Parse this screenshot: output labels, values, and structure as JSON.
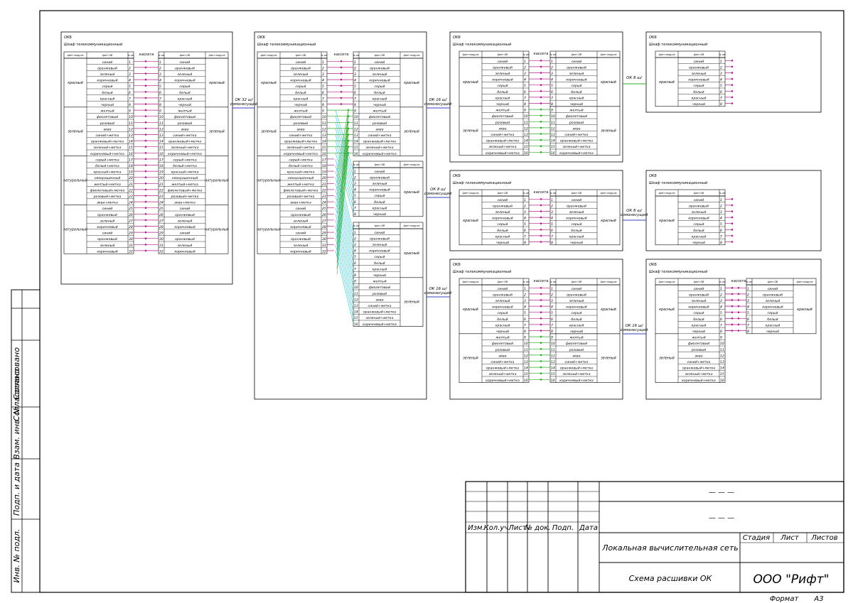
{
  "format": {
    "label": "Формат",
    "value": "А3"
  },
  "side_stamp": [
    "Инв. № подл.",
    "Подп. и дата",
    "Взам. инв. №",
    "Согласовано"
  ],
  "title_block": {
    "columns": [
      "Изм.",
      "Кол.уч.",
      "Лист",
      "№ док.",
      "Подп.",
      "Дата"
    ],
    "code_top": "— — —",
    "code_bottom": "— — —",
    "project": "Локальная вычислительная сеть",
    "sheet_title": "Схема расшивки ОК",
    "stage_hdr": "Стадия",
    "sheet_hdr": "Лист",
    "sheets_hdr": "Листов",
    "company": "ООО \"Рифт\""
  },
  "common": {
    "okb": "ОКБ",
    "cabinet": "Шкаф телекоммуникационный",
    "cassette": "кассета",
    "hdr_module": "Цвет модуля",
    "hdr_fiber": "Цвет ОВ",
    "hdr_num": "№ ОВ"
  },
  "fiber_colors": [
    "синий",
    "оранжевый",
    "зеленый",
    "коричневый",
    "серый",
    "белый",
    "красный",
    "черный",
    "желтый",
    "фиолетовый",
    "розовый",
    "аква",
    "синий+метка",
    "оранжевый+метка",
    "зеленый+метка",
    "коричневый+метка"
  ],
  "fiber_colors_32": [
    "синий",
    "оранжевый",
    "зеленый",
    "коричневый",
    "серый",
    "белый",
    "красный",
    "черный",
    "желтый",
    "фиолетовый",
    "розовый",
    "аква",
    "синий+метка",
    "оранжевый+метка",
    "зеленый+метка",
    "коричневый+метка",
    "серый+метка",
    "белый+метка",
    "красный+метка",
    "неокрашенный",
    "желтый+метка",
    "фиолетовый+метка",
    "розовый+метка",
    "аква+метка",
    "синий",
    "оранжевый",
    "зеленый",
    "коричневый",
    "синий",
    "оранжевый",
    "зеленый",
    "коричневый"
  ],
  "modules": [
    "красный",
    "зеленый",
    "натуральный",
    "натуральный"
  ],
  "cables": [
    {
      "label": "ОК 32 ш/ сомонесущий"
    },
    {
      "label": "ОК 16 ш/ сомонесущий"
    },
    {
      "label": "ОК 8 ш/ сомонесущий"
    },
    {
      "label": "ОК 16 ш/ сомонесущий"
    },
    {
      "label": "ОК 8 ш/"
    },
    {
      "label": "ОК 8 ш/ сомонесущий"
    },
    {
      "label": "ОК 16 ш/ сомонесущий"
    }
  ],
  "right_modules": {
    "red": "красный",
    "green": "зеленый"
  }
}
